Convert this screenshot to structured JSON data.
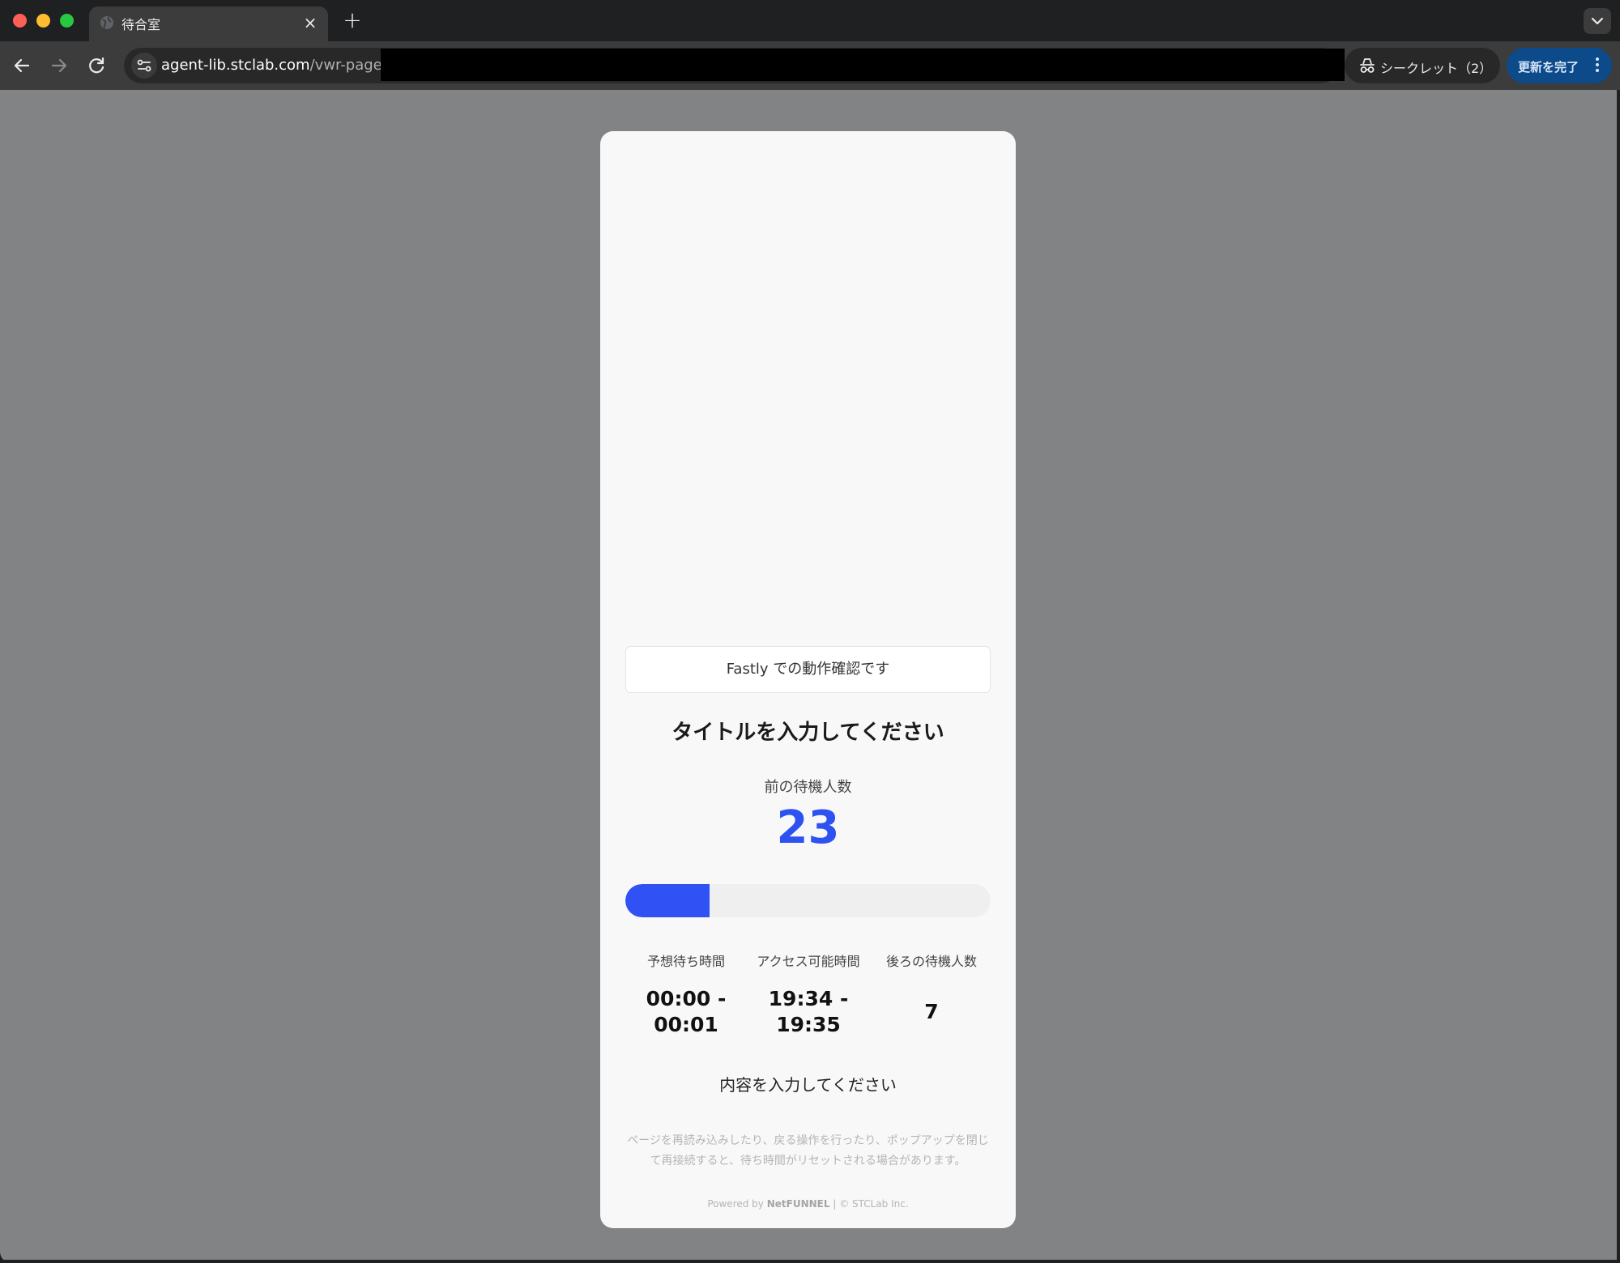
{
  "browser": {
    "tab": {
      "title": "待合室",
      "close": "×"
    },
    "new_tab": "+",
    "url": {
      "host": "agent-lib.stclab.com",
      "path": "/vwr-page/("
    },
    "incognito_label": "シークレット（2）",
    "update_label": "更新を完了"
  },
  "page": {
    "notice": "Fastly での動作確認です",
    "title": "タイトルを入力してください",
    "ahead_label": "前の待機人数",
    "ahead_count": "23",
    "progress_fraction": 0.23,
    "stats": [
      {
        "label": "予想待ち時間",
        "value_line1": "00:00 -",
        "value_line2": "00:01"
      },
      {
        "label": "アクセス可能時間",
        "value_line1": "19:34 -",
        "value_line2": "19:35"
      },
      {
        "label": "後ろの待機人数",
        "value": "7"
      }
    ],
    "content": "内容を入力してください",
    "disclaimer": "ページを再読み込みしたり、戻る操作を行ったり、ポップアップを閉じて再接続すると、待ち時間がリセットされる場合があります。",
    "powered_prefix": "Powered by ",
    "powered_brand": "NetFUNNEL",
    "powered_suffix": " | © STCLab Inc."
  },
  "colors": {
    "accent": "#3052f5",
    "count": "#2e52f2",
    "backdrop": "#828385"
  }
}
